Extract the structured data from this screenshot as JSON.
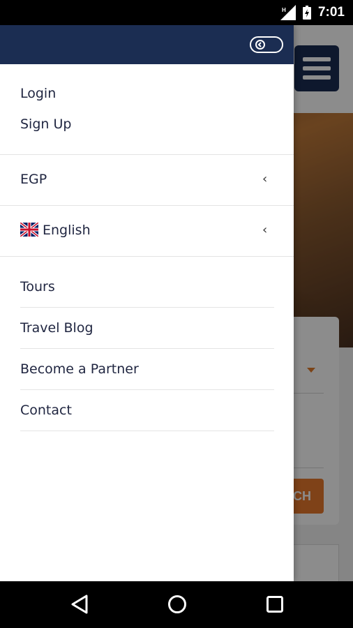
{
  "status_bar": {
    "time": "7:01"
  },
  "drawer": {
    "auth": {
      "login": "Login",
      "signup": "Sign Up"
    },
    "currency": {
      "label": "EGP"
    },
    "language": {
      "label": "English"
    },
    "nav": [
      "Tours",
      "Travel Blog",
      "Become a Partner",
      "Contact"
    ]
  },
  "background_app": {
    "search_button_partial": "CH"
  },
  "colors": {
    "brand_navy": "#1b2d52",
    "accent_orange": "#e8782c"
  },
  "icons": {
    "close_drawer": "toggle-back-icon",
    "menu": "hamburger-icon",
    "currency_chevron": "chevron-left-icon",
    "language_chevron": "chevron-left-icon",
    "flag": "uk-flag-icon",
    "nav_back": "back-triangle-icon",
    "nav_home": "home-circle-icon",
    "nav_recents": "recents-square-icon"
  }
}
